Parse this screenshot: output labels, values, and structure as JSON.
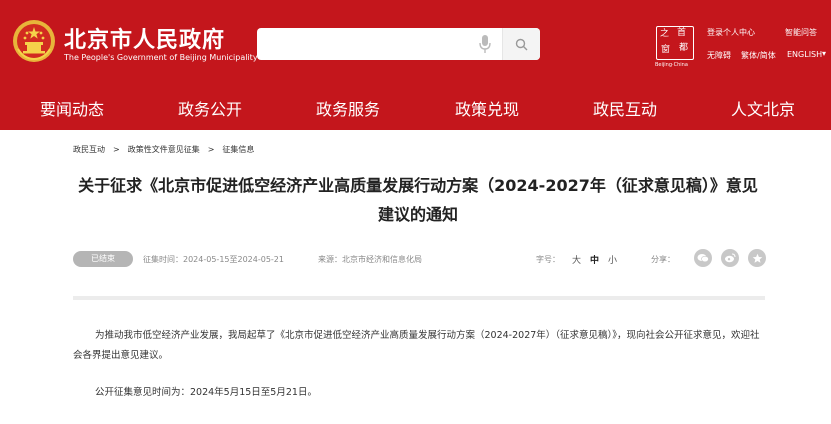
{
  "header": {
    "title": "北京市人民政府",
    "subtitle": "The People's Government of Beijing Municipality",
    "capital_logo": {
      "chars": [
        "之",
        "首",
        "都",
        "窗"
      ],
      "caption": "Beijing·China"
    },
    "search": {
      "value": "",
      "placeholder": ""
    },
    "top_links": {
      "login": "登录个人中心",
      "smart_qa": "智能问答",
      "accessible": "无障碍",
      "trad_simp": "繁体/简体",
      "english": "ENGLISH",
      "dropdown": "▾"
    },
    "colors": {
      "brand_red": "#c4161c"
    }
  },
  "nav": {
    "items": [
      {
        "label": "要闻动态"
      },
      {
        "label": "政务公开"
      },
      {
        "label": "政务服务"
      },
      {
        "label": "政策兑现"
      },
      {
        "label": "政民互动"
      },
      {
        "label": "人文北京"
      }
    ]
  },
  "breadcrumb": {
    "items": [
      "政民互动",
      "政策性文件意见征集",
      "征集信息"
    ],
    "separator": ">"
  },
  "article": {
    "title": "关于征求《北京市促进低空经济产业高质量发展行动方案（2024-2027年（征求意见稿）》意见建议的通知",
    "status": "已结束",
    "period_label": "征集时间：",
    "period_value": "2024-05-15至2024-05-21",
    "source_label": "来源：",
    "source_value": "北京市经济和信息化局",
    "font_size_label": "字号：",
    "font_sizes": [
      "大",
      "中",
      "小"
    ],
    "share_label": "分享：",
    "share_icons": [
      "wechat-icon",
      "weibo-icon",
      "star-icon"
    ],
    "paragraphs": [
      "为推动我市低空经济产业发展，我局起草了《北京市促进低空经济产业高质量发展行动方案（2024-2027年）（征求意见稿）》，现向社会公开征求意见，欢迎社会各界提出意见建议。",
      "公开征集意见时间为：2024年5月15日至5月21日。"
    ]
  }
}
